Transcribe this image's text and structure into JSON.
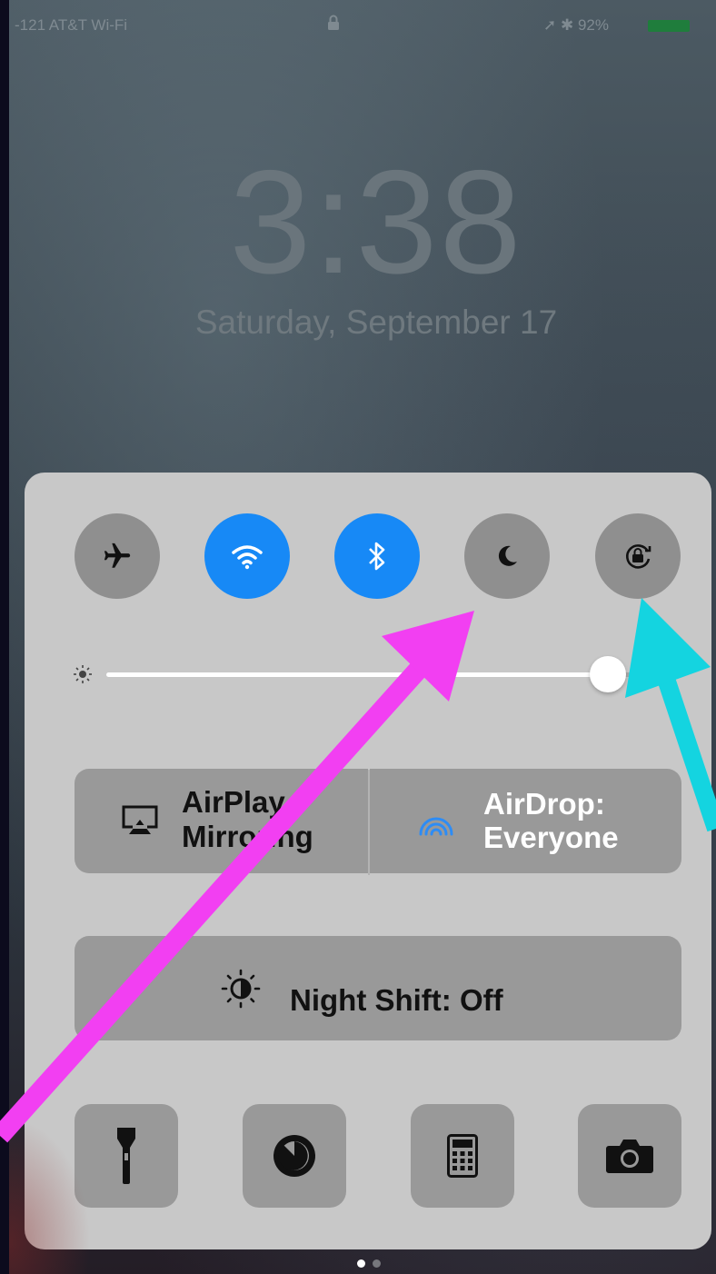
{
  "status_bar": {
    "carrier": "-121 AT&T Wi-Fi",
    "battery_percent": "92%",
    "battery_level": 0.92
  },
  "lock_screen": {
    "time": "3:38",
    "date": "Saturday, September 17"
  },
  "control_center": {
    "toggles": [
      {
        "name": "airplane-mode",
        "state": "off",
        "icon": "airplane-icon"
      },
      {
        "name": "wifi",
        "state": "on",
        "icon": "wifi-icon"
      },
      {
        "name": "bluetooth",
        "state": "on",
        "icon": "bluetooth-icon"
      },
      {
        "name": "do-not-disturb",
        "state": "off",
        "icon": "moon-icon"
      },
      {
        "name": "rotation-lock",
        "state": "off",
        "icon": "rotation-lock-icon"
      }
    ],
    "brightness": 0.94,
    "airplay": {
      "line1": "AirPlay",
      "line2": "Mirroring"
    },
    "airdrop": {
      "line1": "AirDrop:",
      "line2": "Everyone"
    },
    "night_shift_label": "Night Shift: Off",
    "tools": [
      {
        "icon": "flashlight-icon"
      },
      {
        "icon": "timer-icon"
      },
      {
        "icon": "calculator-icon"
      },
      {
        "icon": "camera-icon"
      }
    ]
  },
  "page_indicator": {
    "pages": 2,
    "current": 1
  },
  "annotations": {
    "pink_arrow_color": "#f23ff2",
    "cyan_arrow_color": "#14d4e0"
  },
  "colors": {
    "toggle_on": "#1789f6",
    "toggle_off": "#8f8f8f",
    "panel": "#c8c8c8",
    "button": "#999999"
  }
}
